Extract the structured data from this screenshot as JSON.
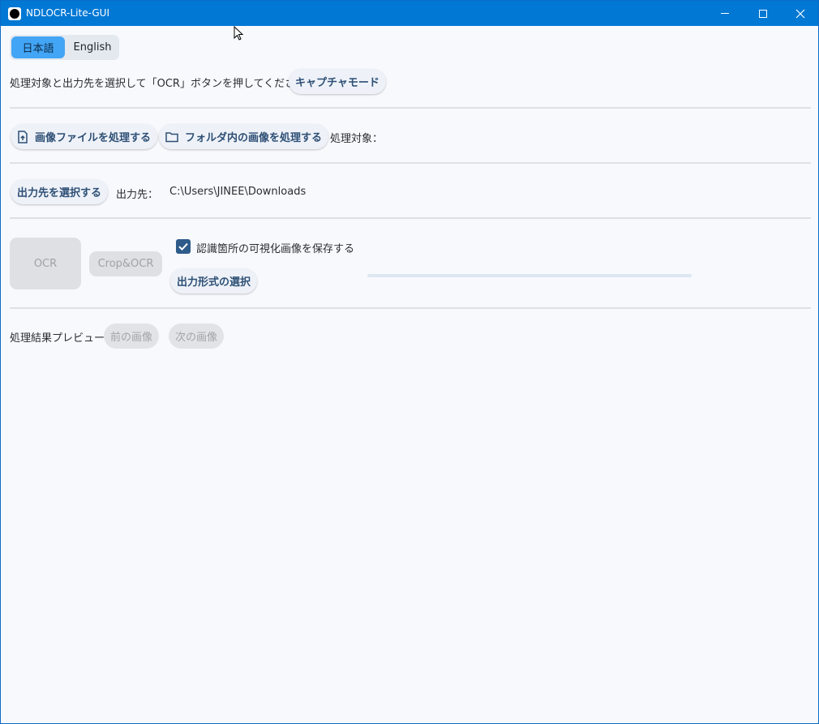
{
  "window": {
    "title": "NDLOCR-Lite-GUI"
  },
  "language": {
    "options": [
      "日本語",
      "English"
    ],
    "selected": "日本語"
  },
  "instruction": {
    "text": "処理対象と出力先を選択して「OCR」ボタンを押してください",
    "capture_button": "キャプチャモード"
  },
  "input": {
    "image_file_button": "画像ファイルを処理する",
    "folder_button": "フォルダ内の画像を処理する",
    "target_label": "処理対象：",
    "target_value": ""
  },
  "output": {
    "select_button": "出力先を選択する",
    "label": "出力先：",
    "path": "C:\\Users\\JINEE\\Downloads"
  },
  "actions": {
    "ocr_button": "OCR",
    "crop_ocr_button": "Crop&OCR",
    "save_visualization_label": "認識箇所の可視化画像を保存する",
    "save_visualization_checked": true,
    "output_format_button": "出力形式の選択",
    "progress": 0
  },
  "preview": {
    "label": "処理結果プレビュー",
    "prev_button": "前の画像",
    "next_button": "次の画像"
  },
  "icons": {
    "app": "app-icon",
    "file_upload": "file-upload-icon",
    "folder": "folder-icon",
    "check": "check-icon"
  },
  "colors": {
    "titlebar": "#0078d4",
    "lang_selected": "#42a5f5",
    "button_text": "#2e4f75",
    "checkbox": "#2e5b8a"
  }
}
